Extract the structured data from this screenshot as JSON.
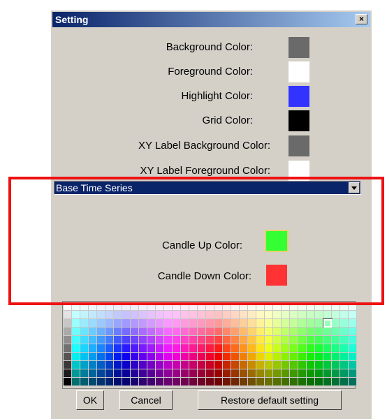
{
  "dialog": {
    "title": "Setting",
    "close_label": "×"
  },
  "color_settings": [
    {
      "label": "Background Color:",
      "color": "#6a6a6a"
    },
    {
      "label": "Foreground Color:",
      "color": "#ffffff"
    },
    {
      "label": "Highlight Color:",
      "color": "#3333ff"
    },
    {
      "label": "Grid Color:",
      "color": "#000000"
    },
    {
      "label": "XY Label Background Color:",
      "color": "#6a6a6a"
    },
    {
      "label": "XY Label Foreground Color:",
      "color": "#ffffff"
    }
  ],
  "series_select": {
    "value": "Base Time Series"
  },
  "candle_settings": [
    {
      "label": "Candle Up Color:",
      "color": "#33ff33"
    },
    {
      "label": "Candle Down Color:",
      "color": "#ff3333"
    }
  ],
  "buttons": {
    "ok": "OK",
    "cancel": "Cancel",
    "restore": "Restore default setting"
  },
  "palette": {
    "columns": 35,
    "rows": 10,
    "selected": {
      "row": 2,
      "col": 31
    }
  },
  "annotation_color": "#ee1111"
}
